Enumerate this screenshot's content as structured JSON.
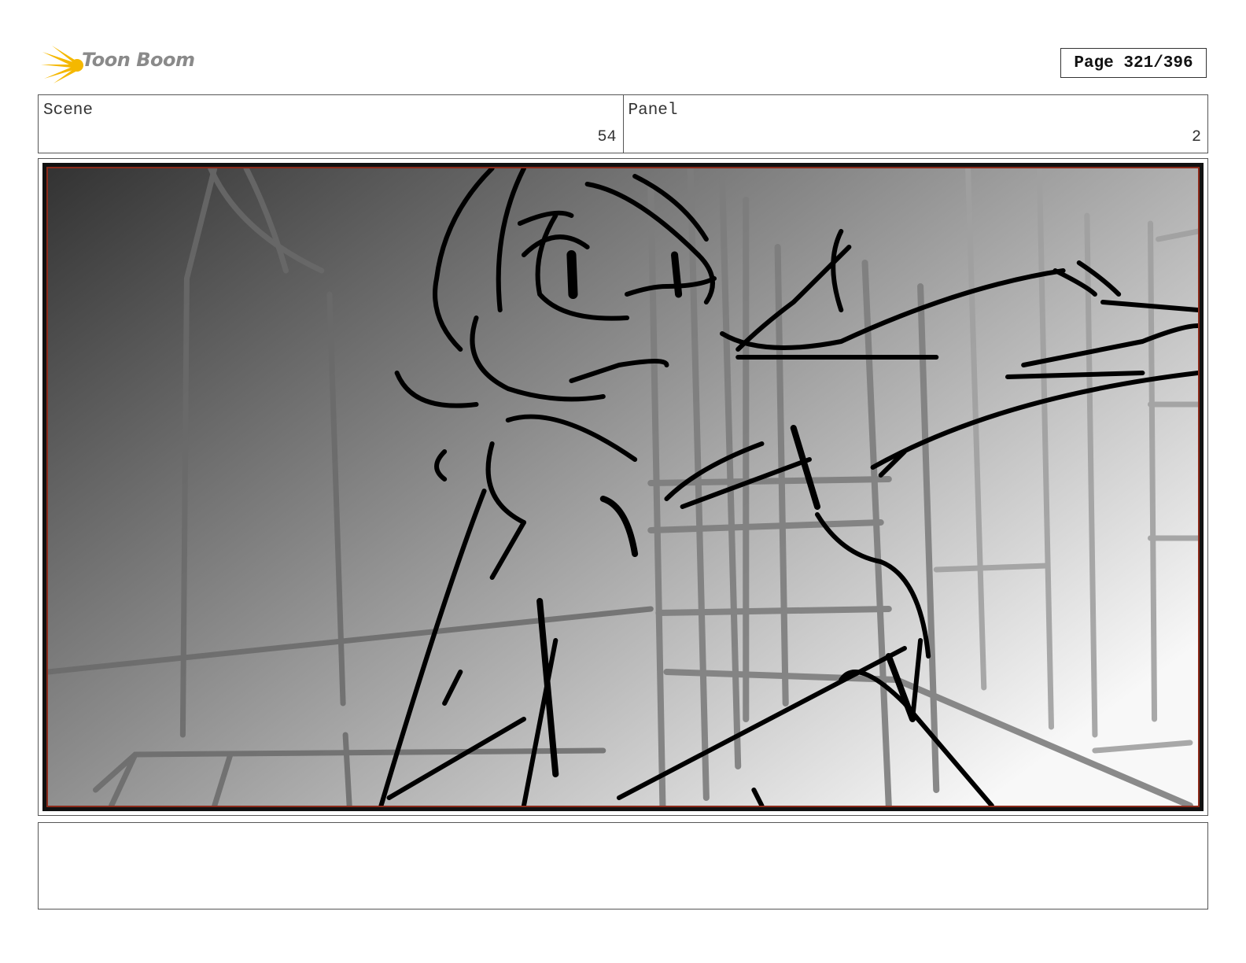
{
  "header": {
    "logo_text": "Toon Boom",
    "page_indicator": "Page 321/396"
  },
  "fields": {
    "scene_label": "Scene",
    "scene_value": "54",
    "panel_label": "Panel",
    "panel_value": "2"
  },
  "notes": {
    "text": ""
  },
  "colors": {
    "logo_accent": "#f5b800",
    "panel_border": "#8b2a1a"
  },
  "icons": {
    "logo": "toon-boom-starburst-icon"
  }
}
